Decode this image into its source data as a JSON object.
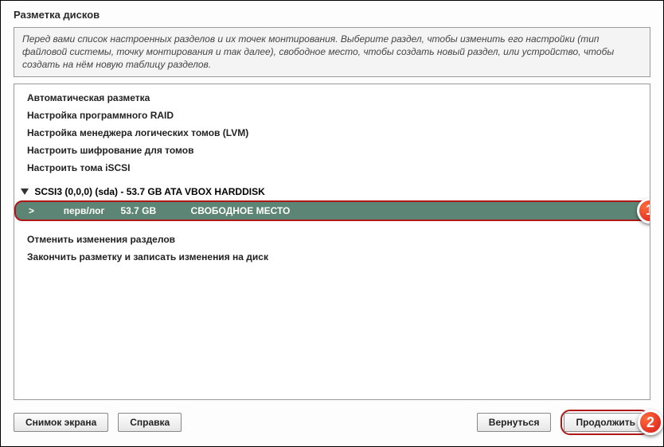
{
  "title": "Разметка дисков",
  "intro": "Перед вами список настроенных разделов и их точек монтирования. Выберите раздел, чтобы изменить его настройки (тип файловой системы, точку монтирования и так далее), свободное место, чтобы создать новый раздел, или устройство, чтобы создать на нём новую таблицу разделов.",
  "options": [
    "Автоматическая разметка",
    "Настройка программного RAID",
    "Настройка менеджера логических томов (LVM)",
    "Настроить шифрование для томов",
    "Настроить тома iSCSI"
  ],
  "disk": {
    "header": "SCSI3 (0,0,0) (sda) - 53.7 GB ATA VBOX HARDDISK",
    "row": {
      "arrow": ">",
      "type": "перв/лог",
      "size": "53.7 GB",
      "label": "СВОБОДНОЕ МЕСТО"
    }
  },
  "actions": [
    "Отменить изменения разделов",
    "Закончить разметку и записать изменения на диск"
  ],
  "buttons": {
    "screenshot": "Снимок экрана",
    "help": "Справка",
    "back": "Вернуться",
    "continue": "Продолжить"
  },
  "markers": {
    "one": "1",
    "two": "2"
  }
}
